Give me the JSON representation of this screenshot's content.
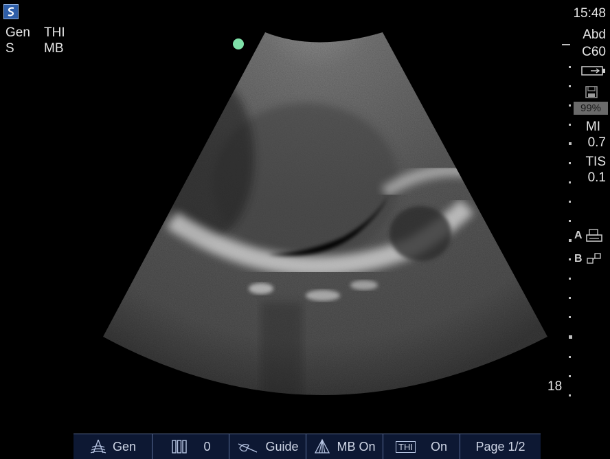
{
  "header_left": {
    "line1_a": "Gen",
    "line1_b": "THI",
    "line2_a": "S",
    "line2_b": "MB"
  },
  "header_right": {
    "time": "15:48",
    "preset": "Abd",
    "transducer": "C60",
    "battery_icon": "battery-icon",
    "storage_icon": "save-icon",
    "storage_percent": "99%",
    "mi_label": "MI",
    "mi_value": "0.7",
    "tis_label": "TIS",
    "tis_value": "0.1",
    "print_a_label": "A",
    "print_a_icon": "printer-icon",
    "print_b_label": "B",
    "print_b_icon": "export-icon",
    "depth": "18"
  },
  "indicator_color": "#7ee0a8",
  "bottom_bar": {
    "gen_icon": "transducer-gain-icon",
    "gen_label": "Gen",
    "gain_icon": "gain-bars-icon",
    "gain_value": "0",
    "guide_icon": "needle-guide-icon",
    "guide_label": "Guide",
    "mb_icon": "multibeam-icon",
    "mb_label": "MB On",
    "thi_badge": "THI",
    "thi_value": "On",
    "page_label": "Page 1/2"
  },
  "colors": {
    "bar_bg": "#0d1833",
    "bar_border": "#5a6e98",
    "logo_bg": "#2e5ea8"
  }
}
